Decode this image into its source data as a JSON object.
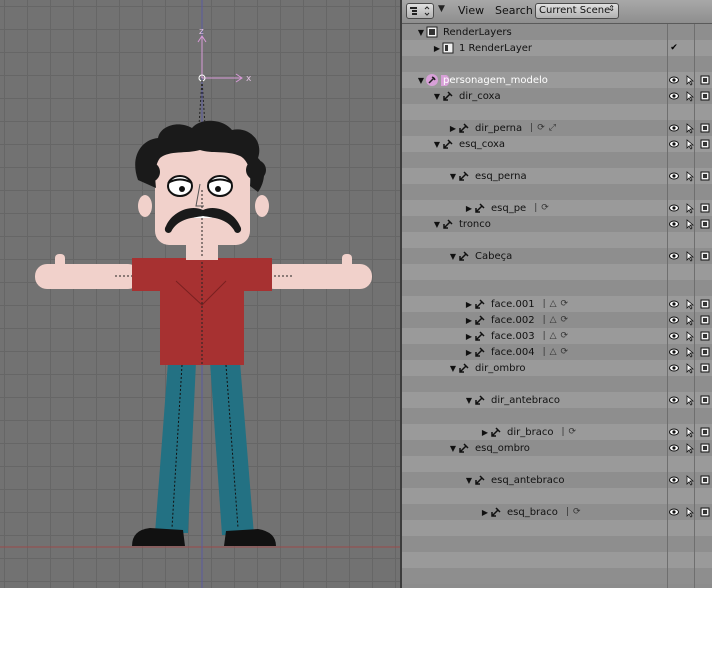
{
  "header": {
    "editor_type_icon": "outliner-icon",
    "menus": [
      "View",
      "Search"
    ],
    "display_mode": "Current Scene"
  },
  "viewport": {
    "axes": {
      "z": "z",
      "x": "x"
    }
  },
  "outliner": {
    "rows": [
      {
        "label": "RenderLayers",
        "indent": 0,
        "arrow": "down",
        "icon": "renderlayers-icon",
        "toggles": false,
        "extras": []
      },
      {
        "label": "1 RenderLayer",
        "indent": 1,
        "arrow": "right",
        "icon": "renderlayer-icon",
        "toggles": false,
        "check": "✔",
        "extras": []
      },
      {
        "label": "",
        "indent": 0,
        "arrow": "",
        "icon": "",
        "toggles": false,
        "extras": []
      },
      {
        "label": "personagem_modelo",
        "indent": 0,
        "arrow": "down",
        "icon": "armature-icon",
        "toggles": true,
        "selected": true,
        "extras": []
      },
      {
        "label": "dir_coxa",
        "indent": 1,
        "arrow": "down",
        "icon": "bone-icon",
        "toggles": true,
        "extras": []
      },
      {
        "label": "",
        "indent": 0,
        "arrow": "",
        "icon": "",
        "toggles": false,
        "extras": []
      },
      {
        "label": "dir_perna",
        "indent": 2,
        "arrow": "right",
        "icon": "bone-icon",
        "toggles": true,
        "extras": [
          "|",
          "constraint-icon",
          "bone-icon"
        ]
      },
      {
        "label": "esq_coxa",
        "indent": 1,
        "arrow": "down",
        "icon": "bone-icon",
        "toggles": true,
        "extras": []
      },
      {
        "label": "",
        "indent": 0,
        "arrow": "",
        "icon": "",
        "toggles": false,
        "extras": []
      },
      {
        "label": "esq_perna",
        "indent": 2,
        "arrow": "down",
        "icon": "bone-icon",
        "toggles": true,
        "extras": []
      },
      {
        "label": "",
        "indent": 0,
        "arrow": "",
        "icon": "",
        "toggles": false,
        "extras": []
      },
      {
        "label": "esq_pe",
        "indent": 3,
        "arrow": "right",
        "icon": "bone-icon",
        "toggles": true,
        "extras": [
          "|",
          "constraint-icon"
        ]
      },
      {
        "label": "tronco",
        "indent": 1,
        "arrow": "down",
        "icon": "bone-icon",
        "toggles": true,
        "extras": []
      },
      {
        "label": "",
        "indent": 0,
        "arrow": "",
        "icon": "",
        "toggles": false,
        "extras": []
      },
      {
        "label": "Cabeça",
        "indent": 2,
        "arrow": "down",
        "icon": "bone-icon",
        "toggles": true,
        "extras": []
      },
      {
        "label": "",
        "indent": 0,
        "arrow": "",
        "icon": "",
        "toggles": false,
        "extras": []
      },
      {
        "label": "",
        "indent": 0,
        "arrow": "",
        "icon": "",
        "toggles": false,
        "extras": []
      },
      {
        "label": "face.001",
        "indent": 3,
        "arrow": "right",
        "icon": "bone-icon",
        "toggles": true,
        "extras": [
          "|",
          "modifier-icon",
          "constraint-icon"
        ]
      },
      {
        "label": "face.002",
        "indent": 3,
        "arrow": "right",
        "icon": "bone-icon",
        "toggles": true,
        "extras": [
          "|",
          "modifier-icon",
          "constraint-icon"
        ]
      },
      {
        "label": "face.003",
        "indent": 3,
        "arrow": "right",
        "icon": "bone-icon",
        "toggles": true,
        "extras": [
          "|",
          "modifier-icon",
          "constraint-icon"
        ]
      },
      {
        "label": "face.004",
        "indent": 3,
        "arrow": "right",
        "icon": "bone-icon",
        "toggles": true,
        "extras": [
          "|",
          "modifier-icon",
          "constraint-icon"
        ]
      },
      {
        "label": "dir_ombro",
        "indent": 2,
        "arrow": "down",
        "icon": "bone-icon",
        "toggles": true,
        "extras": []
      },
      {
        "label": "",
        "indent": 0,
        "arrow": "",
        "icon": "",
        "toggles": false,
        "extras": []
      },
      {
        "label": "dir_antebraco",
        "indent": 3,
        "arrow": "down",
        "icon": "bone-icon",
        "toggles": true,
        "extras": []
      },
      {
        "label": "",
        "indent": 0,
        "arrow": "",
        "icon": "",
        "toggles": false,
        "extras": []
      },
      {
        "label": "dir_braco",
        "indent": 4,
        "arrow": "right",
        "icon": "bone-icon",
        "toggles": true,
        "extras": [
          "|",
          "constraint-icon"
        ]
      },
      {
        "label": "esq_ombro",
        "indent": 2,
        "arrow": "down",
        "icon": "bone-icon",
        "toggles": true,
        "extras": []
      },
      {
        "label": "",
        "indent": 0,
        "arrow": "",
        "icon": "",
        "toggles": false,
        "extras": []
      },
      {
        "label": "esq_antebraco",
        "indent": 3,
        "arrow": "down",
        "icon": "bone-icon",
        "toggles": true,
        "extras": []
      },
      {
        "label": "",
        "indent": 0,
        "arrow": "",
        "icon": "",
        "toggles": false,
        "extras": []
      },
      {
        "label": "esq_braco",
        "indent": 4,
        "arrow": "right",
        "icon": "bone-icon",
        "toggles": true,
        "extras": [
          "|",
          "constraint-icon"
        ]
      },
      {
        "label": "",
        "indent": 0,
        "arrow": "",
        "icon": "",
        "toggles": false,
        "extras": []
      },
      {
        "label": "",
        "indent": 0,
        "arrow": "",
        "icon": "",
        "toggles": false,
        "extras": []
      },
      {
        "label": "",
        "indent": 0,
        "arrow": "",
        "icon": "",
        "toggles": false,
        "extras": []
      },
      {
        "label": "",
        "indent": 0,
        "arrow": "",
        "icon": "",
        "toggles": false,
        "extras": []
      }
    ]
  },
  "colors": {
    "shirt": "#a73131",
    "pants": "#237183",
    "skin": "#f1d1cb",
    "hair": "#1a1a1a",
    "viewport_bg": "#727272",
    "selected_text": "#ffffff"
  }
}
